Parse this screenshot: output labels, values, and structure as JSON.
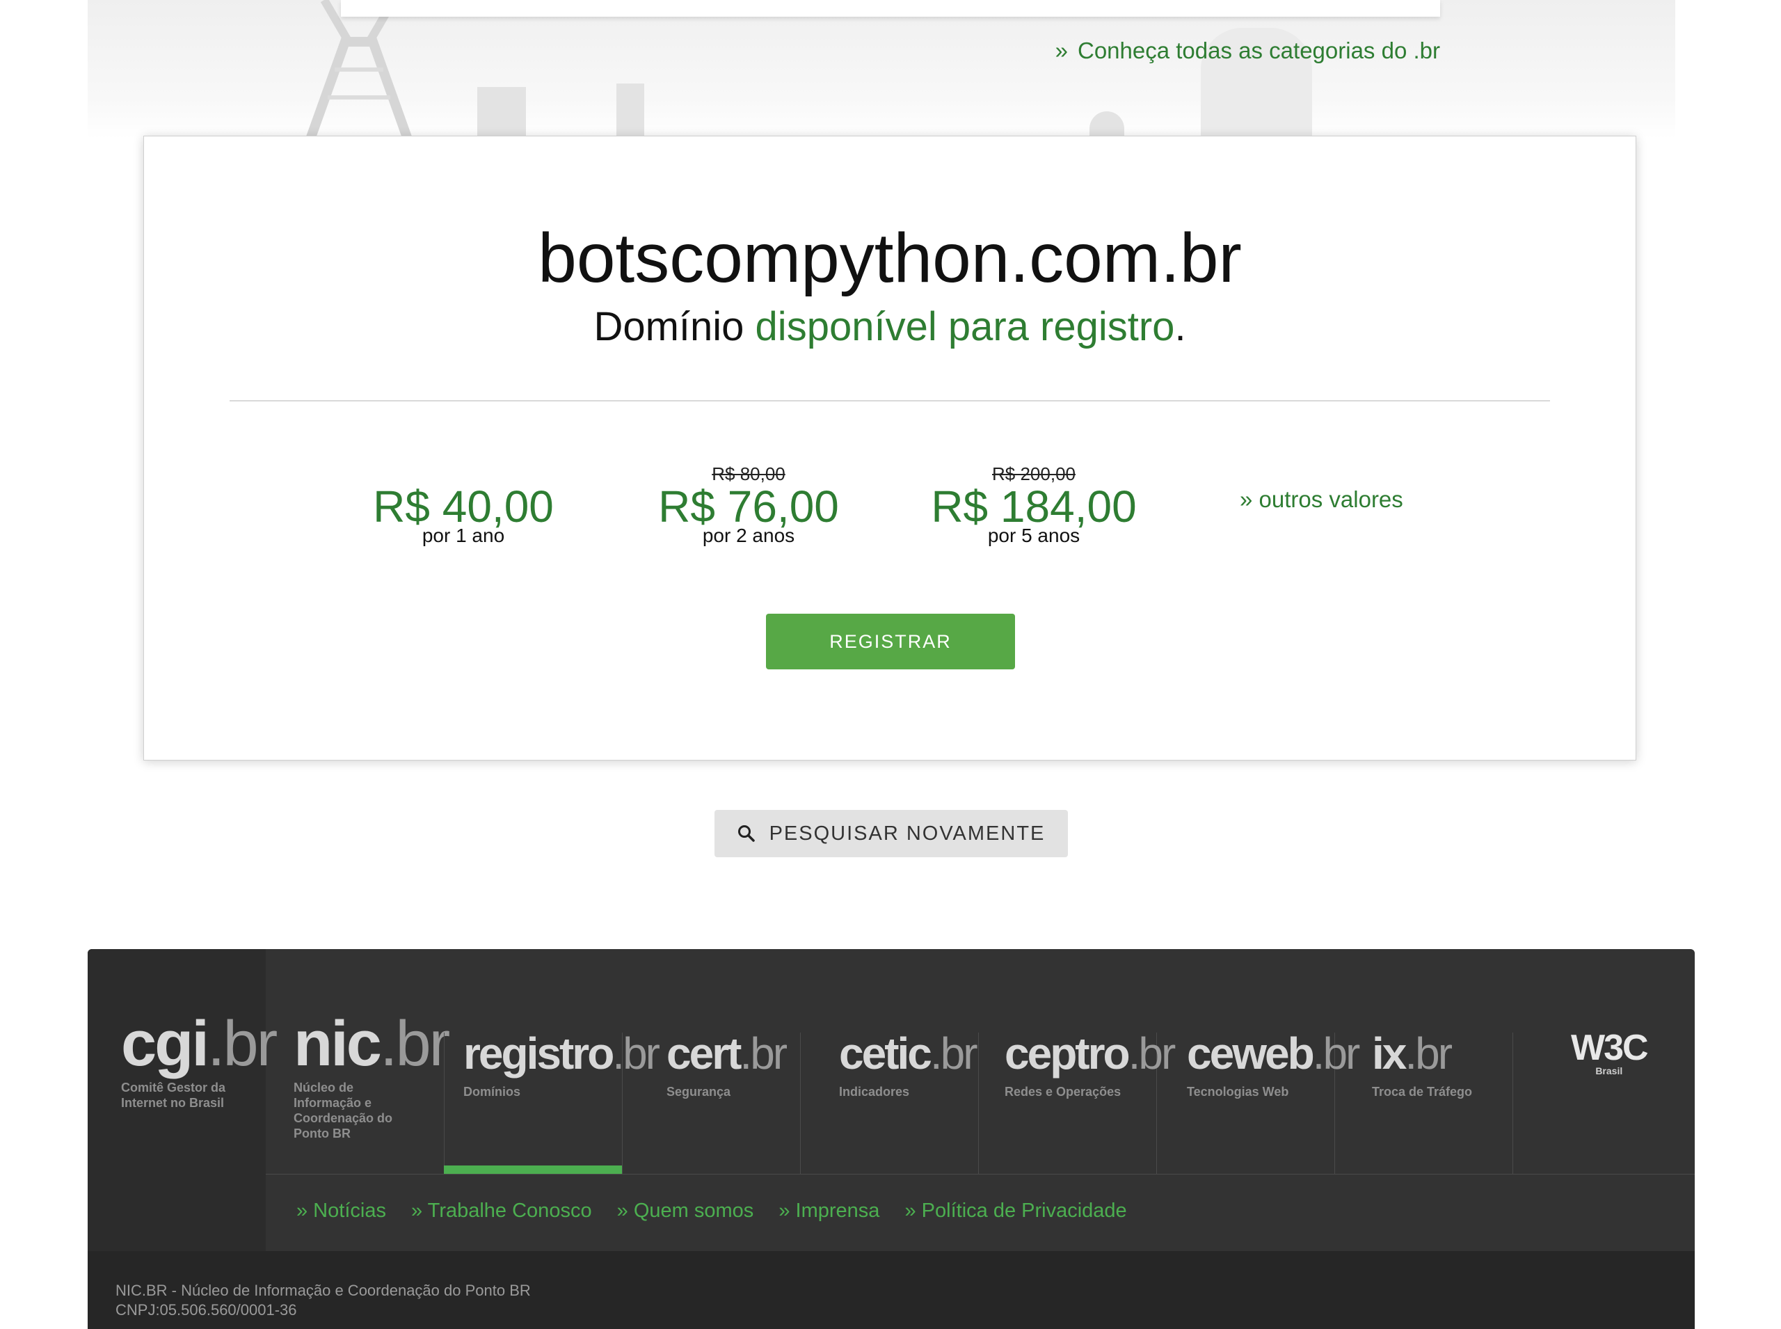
{
  "top": {
    "categories_link": "Conheça todas as categorias do .br",
    "link_prefix": "»"
  },
  "result": {
    "domain": "botscompython.com.br",
    "status_prefix": "Domínio",
    "status_highlight": "disponível para registro",
    "status_suffix": ".",
    "prices": [
      {
        "old": "",
        "value": "R$ 40,00",
        "period": "por 1 ano"
      },
      {
        "old": "R$ 80,00",
        "value": "R$ 76,00",
        "period": "por 2 anos"
      },
      {
        "old": "R$ 200,00",
        "value": "R$ 184,00",
        "period": "por 5 anos"
      }
    ],
    "other_values": "» outros valores",
    "register_button": "REGISTRAR"
  },
  "search_again_button": "PESQUISAR NOVAMENTE",
  "footer": {
    "logos": [
      {
        "name": "cgi",
        "suffix": ".br",
        "sub": "Comitê Gestor da Internet no Brasil"
      },
      {
        "name": "nic",
        "suffix": ".br",
        "sub": "Núcleo de Informação e Coordenação do Ponto BR"
      },
      {
        "name": "registro",
        "suffix": ".br",
        "sub": "Domínios"
      },
      {
        "name": "cert",
        "suffix": ".br",
        "sub": "Segurança"
      },
      {
        "name": "cetic",
        "suffix": ".br",
        "sub": "Indicadores"
      },
      {
        "name": "ceptro",
        "suffix": ".br",
        "sub": "Redes e Operações"
      },
      {
        "name": "ceweb",
        "suffix": ".br",
        "sub": "Tecnologias Web"
      },
      {
        "name": "ix",
        "suffix": ".br",
        "sub": "Troca de Tráfego"
      },
      {
        "name": "W3C",
        "suffix": "",
        "sub": "Brasil"
      }
    ],
    "links": [
      "» Notícias",
      "» Trabalhe Conosco",
      "» Quem somos",
      "» Imprensa",
      "» Política de Privacidade"
    ],
    "org_name": "NIC.BR - Núcleo de Informação e Coordenação do Ponto BR",
    "cnpj": "CNPJ:05.506.560/0001-36"
  },
  "colors": {
    "accent_green": "#2e7d32",
    "button_green": "#57a846",
    "footer_bg": "#333333"
  }
}
